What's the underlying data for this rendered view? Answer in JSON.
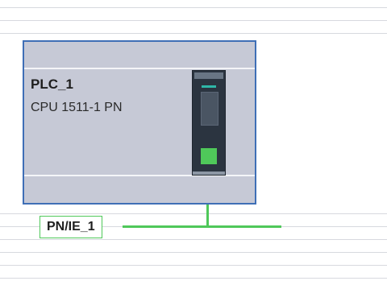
{
  "device": {
    "name": "PLC_1",
    "type": "CPU 1511-1 PN"
  },
  "network": {
    "name": "PN/IE_1"
  },
  "colors": {
    "device_body": "#c6c9d6",
    "device_border": "#3f6fb6",
    "cpu_module": "#2b3440",
    "network_line": "#4fc85a"
  },
  "icons": [
    "cpu-module-icon",
    "profinet-port-icon"
  ]
}
